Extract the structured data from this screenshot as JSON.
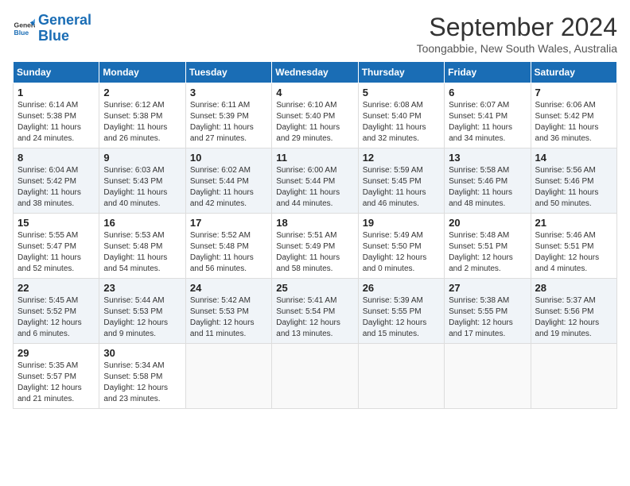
{
  "header": {
    "logo_line1": "General",
    "logo_line2": "Blue",
    "month_title": "September 2024",
    "location": "Toongabbie, New South Wales, Australia"
  },
  "weekdays": [
    "Sunday",
    "Monday",
    "Tuesday",
    "Wednesday",
    "Thursday",
    "Friday",
    "Saturday"
  ],
  "weeks": [
    [
      {
        "day": "1",
        "info": "Sunrise: 6:14 AM\nSunset: 5:38 PM\nDaylight: 11 hours\nand 24 minutes."
      },
      {
        "day": "2",
        "info": "Sunrise: 6:12 AM\nSunset: 5:38 PM\nDaylight: 11 hours\nand 26 minutes."
      },
      {
        "day": "3",
        "info": "Sunrise: 6:11 AM\nSunset: 5:39 PM\nDaylight: 11 hours\nand 27 minutes."
      },
      {
        "day": "4",
        "info": "Sunrise: 6:10 AM\nSunset: 5:40 PM\nDaylight: 11 hours\nand 29 minutes."
      },
      {
        "day": "5",
        "info": "Sunrise: 6:08 AM\nSunset: 5:40 PM\nDaylight: 11 hours\nand 32 minutes."
      },
      {
        "day": "6",
        "info": "Sunrise: 6:07 AM\nSunset: 5:41 PM\nDaylight: 11 hours\nand 34 minutes."
      },
      {
        "day": "7",
        "info": "Sunrise: 6:06 AM\nSunset: 5:42 PM\nDaylight: 11 hours\nand 36 minutes."
      }
    ],
    [
      {
        "day": "8",
        "info": "Sunrise: 6:04 AM\nSunset: 5:42 PM\nDaylight: 11 hours\nand 38 minutes."
      },
      {
        "day": "9",
        "info": "Sunrise: 6:03 AM\nSunset: 5:43 PM\nDaylight: 11 hours\nand 40 minutes."
      },
      {
        "day": "10",
        "info": "Sunrise: 6:02 AM\nSunset: 5:44 PM\nDaylight: 11 hours\nand 42 minutes."
      },
      {
        "day": "11",
        "info": "Sunrise: 6:00 AM\nSunset: 5:44 PM\nDaylight: 11 hours\nand 44 minutes."
      },
      {
        "day": "12",
        "info": "Sunrise: 5:59 AM\nSunset: 5:45 PM\nDaylight: 11 hours\nand 46 minutes."
      },
      {
        "day": "13",
        "info": "Sunrise: 5:58 AM\nSunset: 5:46 PM\nDaylight: 11 hours\nand 48 minutes."
      },
      {
        "day": "14",
        "info": "Sunrise: 5:56 AM\nSunset: 5:46 PM\nDaylight: 11 hours\nand 50 minutes."
      }
    ],
    [
      {
        "day": "15",
        "info": "Sunrise: 5:55 AM\nSunset: 5:47 PM\nDaylight: 11 hours\nand 52 minutes."
      },
      {
        "day": "16",
        "info": "Sunrise: 5:53 AM\nSunset: 5:48 PM\nDaylight: 11 hours\nand 54 minutes."
      },
      {
        "day": "17",
        "info": "Sunrise: 5:52 AM\nSunset: 5:48 PM\nDaylight: 11 hours\nand 56 minutes."
      },
      {
        "day": "18",
        "info": "Sunrise: 5:51 AM\nSunset: 5:49 PM\nDaylight: 11 hours\nand 58 minutes."
      },
      {
        "day": "19",
        "info": "Sunrise: 5:49 AM\nSunset: 5:50 PM\nDaylight: 12 hours\nand 0 minutes."
      },
      {
        "day": "20",
        "info": "Sunrise: 5:48 AM\nSunset: 5:51 PM\nDaylight: 12 hours\nand 2 minutes."
      },
      {
        "day": "21",
        "info": "Sunrise: 5:46 AM\nSunset: 5:51 PM\nDaylight: 12 hours\nand 4 minutes."
      }
    ],
    [
      {
        "day": "22",
        "info": "Sunrise: 5:45 AM\nSunset: 5:52 PM\nDaylight: 12 hours\nand 6 minutes."
      },
      {
        "day": "23",
        "info": "Sunrise: 5:44 AM\nSunset: 5:53 PM\nDaylight: 12 hours\nand 9 minutes."
      },
      {
        "day": "24",
        "info": "Sunrise: 5:42 AM\nSunset: 5:53 PM\nDaylight: 12 hours\nand 11 minutes."
      },
      {
        "day": "25",
        "info": "Sunrise: 5:41 AM\nSunset: 5:54 PM\nDaylight: 12 hours\nand 13 minutes."
      },
      {
        "day": "26",
        "info": "Sunrise: 5:39 AM\nSunset: 5:55 PM\nDaylight: 12 hours\nand 15 minutes."
      },
      {
        "day": "27",
        "info": "Sunrise: 5:38 AM\nSunset: 5:55 PM\nDaylight: 12 hours\nand 17 minutes."
      },
      {
        "day": "28",
        "info": "Sunrise: 5:37 AM\nSunset: 5:56 PM\nDaylight: 12 hours\nand 19 minutes."
      }
    ],
    [
      {
        "day": "29",
        "info": "Sunrise: 5:35 AM\nSunset: 5:57 PM\nDaylight: 12 hours\nand 21 minutes."
      },
      {
        "day": "30",
        "info": "Sunrise: 5:34 AM\nSunset: 5:58 PM\nDaylight: 12 hours\nand 23 minutes."
      },
      {
        "day": "",
        "info": ""
      },
      {
        "day": "",
        "info": ""
      },
      {
        "day": "",
        "info": ""
      },
      {
        "day": "",
        "info": ""
      },
      {
        "day": "",
        "info": ""
      }
    ]
  ]
}
